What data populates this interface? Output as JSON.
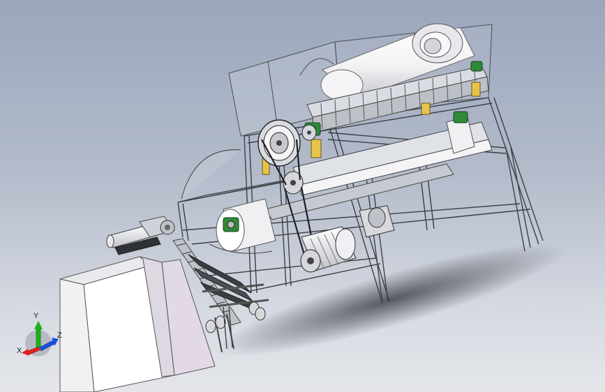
{
  "viewport": {
    "background_top": "#9aa6bc",
    "background_bottom": "#e4e6ea"
  },
  "triad": {
    "x_label": "X",
    "y_label": "Y",
    "z_label": "Z",
    "x_color": "#e0201a",
    "y_color": "#19b319",
    "z_color": "#1a4fe0"
  }
}
